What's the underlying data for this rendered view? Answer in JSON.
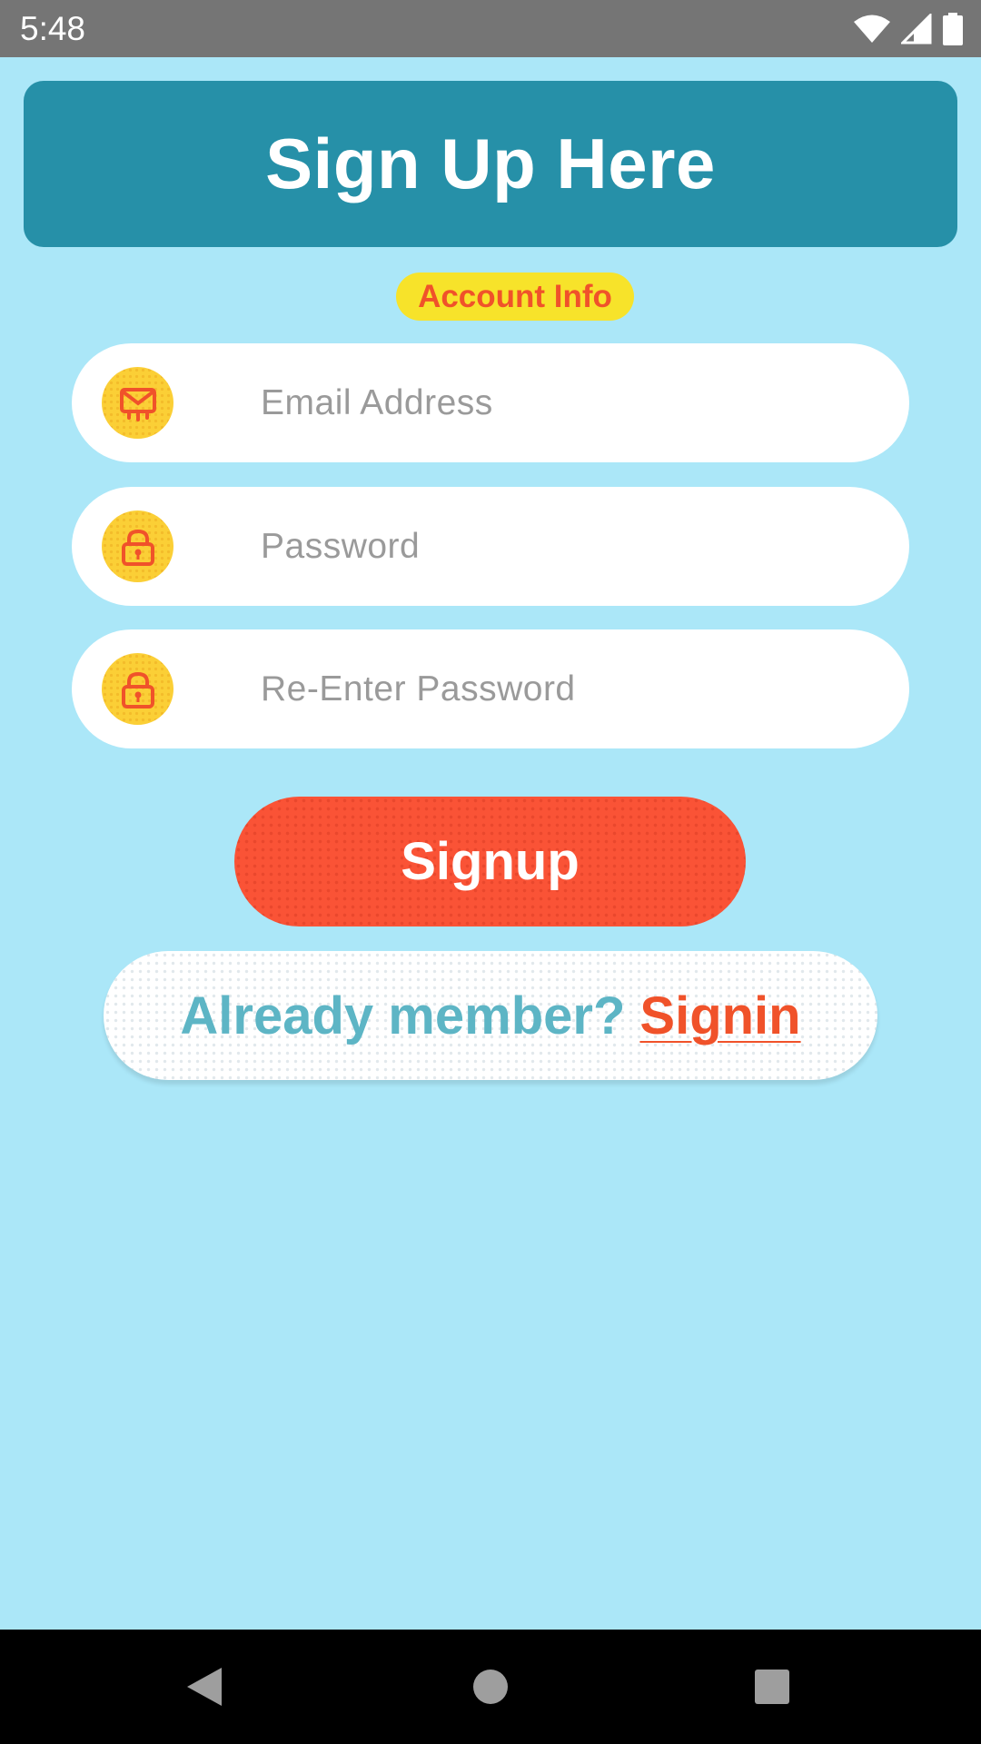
{
  "status_bar": {
    "time": "5:48",
    "icons": [
      "wifi-icon",
      "cellular-signal-icon",
      "battery-icon"
    ]
  },
  "header": {
    "title": "Sign Up Here"
  },
  "section": {
    "label": "Account Info"
  },
  "form": {
    "fields": [
      {
        "icon": "envelope-icon",
        "placeholder": "Email Address",
        "value": ""
      },
      {
        "icon": "lock-icon",
        "placeholder": "Password",
        "value": ""
      },
      {
        "icon": "lock-icon",
        "placeholder": "Re-Enter Password",
        "value": ""
      }
    ],
    "submit_label": "Signup"
  },
  "signin": {
    "prompt": "Already member?",
    "link_label": "Signin"
  },
  "nav_bar": {
    "buttons": [
      "back-icon",
      "home-icon",
      "recents-icon"
    ]
  },
  "colors": {
    "background": "#ABE7F8",
    "header": "#2690A8",
    "badge": "#F7E32A",
    "accent": "#F0522A",
    "icon_circle": "#FBCF36",
    "signin_prompt": "#5DB5C5"
  }
}
